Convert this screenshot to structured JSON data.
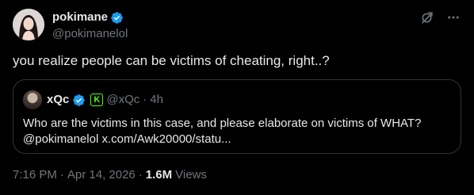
{
  "author": {
    "display_name": "pokimane",
    "handle": "@pokimanelol",
    "avatar_icon": "user-avatar-photo",
    "verified": true
  },
  "actions": {
    "grok_icon": "grok-icon",
    "more_icon": "more-icon"
  },
  "tweet": {
    "text": "you realize people can be victims of cheating, right..?"
  },
  "quote": {
    "display_name": "xQc",
    "badge": "K",
    "handle": "@xQc",
    "dot": "·",
    "time": "4h",
    "text_line1": "Who are the victims in this case, and please elaborate on victims of WHAT?",
    "text_line2": "@pokimanelol x.com/Awk20000/statu..."
  },
  "meta": {
    "time": "7:16 PM",
    "dot1": "·",
    "date": "Apr 14, 2026",
    "dot2": "·",
    "views_count": "1.6M",
    "views_label": "Views"
  },
  "colors": {
    "background": "#000000",
    "text_primary": "#e7e9ea",
    "text_secondary": "#71767b",
    "verified_blue": "#1d9bf0",
    "kick_green": "#53fc18",
    "border": "#2f3336"
  }
}
